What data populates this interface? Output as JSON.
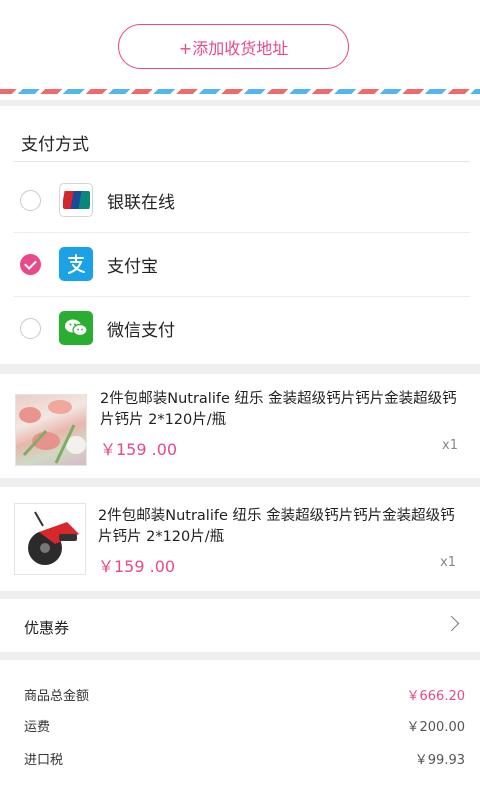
{
  "address": {
    "add_button_label": "+添加收货地址"
  },
  "payment": {
    "title": "支付方式",
    "methods": [
      {
        "label": "银联在线",
        "icon": "unionpay-icon",
        "selected": false
      },
      {
        "label": "支付宝",
        "icon": "alipay-icon",
        "selected": true
      },
      {
        "label": "微信支付",
        "icon": "wechat-pay-icon",
        "selected": false
      }
    ]
  },
  "orders": [
    {
      "title": "2件包邮装Nutralife 纽乐 金装超级钙片钙片金装超级钙片钙片 2*120片/瓶",
      "price": "￥159 .00",
      "qty": "x1",
      "thumb": "flower-product-image"
    },
    {
      "title": "2件包邮装Nutralife 纽乐 金装超级钙片钙片金装超级钙片钙片 2*120片/瓶",
      "price": "￥159 .00",
      "qty": "x1",
      "thumb": "circular-saw-product-image"
    }
  ],
  "coupon": {
    "label": "优惠券"
  },
  "summary": {
    "rows": [
      {
        "label": "商品总金额",
        "value": "￥666.20"
      },
      {
        "label": "运费",
        "value": "￥200.00"
      },
      {
        "label": "进口税",
        "value": "￥99.93"
      }
    ]
  },
  "colors": {
    "accent": "#e8498a",
    "alipay": "#1ba2e6",
    "wechat": "#2aae32"
  }
}
